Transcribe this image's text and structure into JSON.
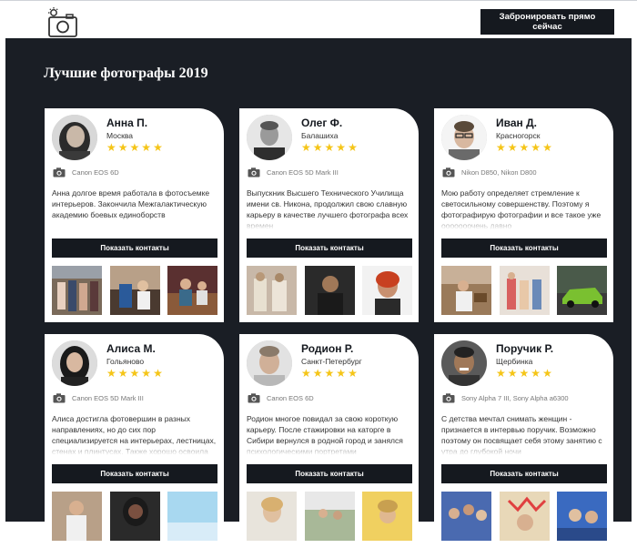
{
  "header": {
    "cta_label": "Забронировать прямо сейчас",
    "logo_icon": "camera-logo-icon"
  },
  "main": {
    "title": "Лучшие фотографы 2019",
    "contact_label": "Показать контакты",
    "star_color": "#f5c518",
    "photographers": [
      {
        "name": "Анна П.",
        "city": "Москва",
        "rating": 5,
        "camera": "Canon EOS 6D",
        "bio": "Анна долгое время работала в фотосъемке интерьеров. Закончила Межгалактическую академию боевых единоборств"
      },
      {
        "name": "Олег Ф.",
        "city": "Балашиха",
        "rating": 5,
        "camera": "Canon EOS 5D Mark III",
        "bio": "Выпускник Высшего Технического Училища имени св. Никона, продолжил свою славную карьеру в качестве лучшего фотографа всех времен"
      },
      {
        "name": "Иван Д.",
        "city": "Красногорск",
        "rating": 5,
        "camera": "Nikon D850, Nikon D800",
        "bio": "Мою работу определяет стремление к светосильному совершенству. Поэтому я фотографирую фотографии и все такое уже ооооооочень давно"
      },
      {
        "name": "Алиса М.",
        "city": "Гольяново",
        "rating": 5,
        "camera": "Canon EOS 5D Mark III",
        "bio": "Алиса достигла фотовершин в разных направлениях, но до сих пор специализируется на интерьерах, лестницах, стенах и плинтусах. Также хорошо освоила"
      },
      {
        "name": "Родион Р.",
        "city": "Санкт-Петербург",
        "rating": 5,
        "camera": "Canon EOS 6D",
        "bio": "Родион многое повидал за свою короткую карьеру. После стажировки на каторге в Сибири вернулся в родной город и занялся психологическими портретами"
      },
      {
        "name": "Поручик Р.",
        "city": "Щербинка",
        "rating": 5,
        "camera": "Sony Alpha 7 III, Sony Alpha a6300",
        "bio": "С детства мечтал снимать женщин - признается в интервью поручик. Возможно поэтому он посвящает себя этому занятию с утра до глубокой ночи"
      }
    ]
  }
}
